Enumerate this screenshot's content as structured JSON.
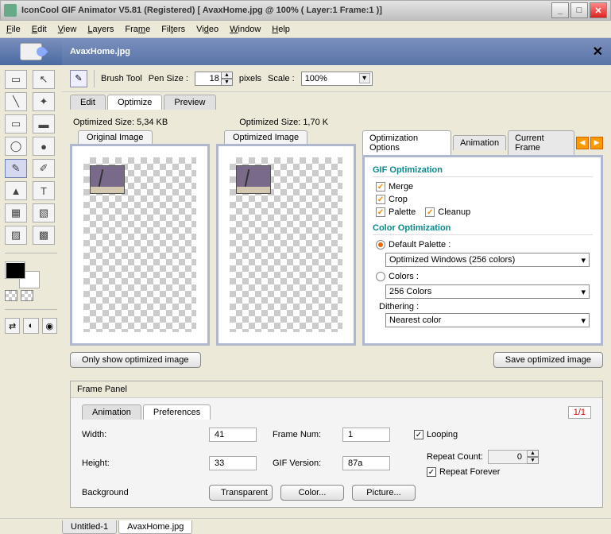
{
  "titlebar": {
    "title": "IconCool GIF Animator V5.81 (Registered) [ AvaxHome.jpg @ 100% ( Layer:1 Frame:1 )]"
  },
  "menu": {
    "file": "File",
    "edit": "Edit",
    "view": "View",
    "layers": "Layers",
    "frame": "Frame",
    "filters": "Filters",
    "video": "Video",
    "window": "Window",
    "help": "Help"
  },
  "doc": {
    "name": "AvaxHome.jpg"
  },
  "brushbar": {
    "tool_label": "Brush Tool",
    "pensize_label": "Pen Size :",
    "pensize_value": "18",
    "pixels": "pixels",
    "scale_label": "Scale :",
    "scale_value": "100%"
  },
  "maintabs": {
    "edit": "Edit",
    "optimize": "Optimize",
    "preview": "Preview"
  },
  "sizes": {
    "original": "Optimized Size: 5,34 KB",
    "optimized": "Optimized Size: 1,70 K"
  },
  "panes": {
    "original": "Original Image",
    "optimized": "Optimized Image"
  },
  "opttabs": {
    "options": "Optimization  Options",
    "animation": "Animation",
    "current": "Current Frame"
  },
  "gif": {
    "section": "GIF Optimization",
    "merge": "Merge",
    "crop": "Crop",
    "palette": "Palette",
    "cleanup": "Cleanup",
    "color_section": "Color Optimization",
    "default_palette": "Default Palette :",
    "palette_value": "Optimized Windows (256 colors)",
    "colors_label": "Colors :",
    "colors_value": "256 Colors",
    "dither_label": "Dithering :",
    "dither_value": "Nearest color"
  },
  "buttons": {
    "only_optimized": "Only show optimized image",
    "save_optimized": "Save optimized image",
    "transparent": "Transparent",
    "color": "Color...",
    "picture": "Picture..."
  },
  "framepanel": {
    "title": "Frame Panel",
    "tab_anim": "Animation",
    "tab_pref": "Preferences",
    "count": "1/1",
    "width_label": "Width:",
    "width_value": "41",
    "height_label": "Height:",
    "height_value": "33",
    "framenum_label": "Frame Num:",
    "framenum_value": "1",
    "gifver_label": "GIF Version:",
    "gifver_value": "87a",
    "looping": "Looping",
    "repeatcount_label": "Repeat Count:",
    "repeatcount_value": "0",
    "repeatforever": "Repeat Forever",
    "background_label": "Background"
  },
  "bottomtabs": {
    "untitled": "Untitled-1",
    "avax": "AvaxHome.jpg"
  }
}
